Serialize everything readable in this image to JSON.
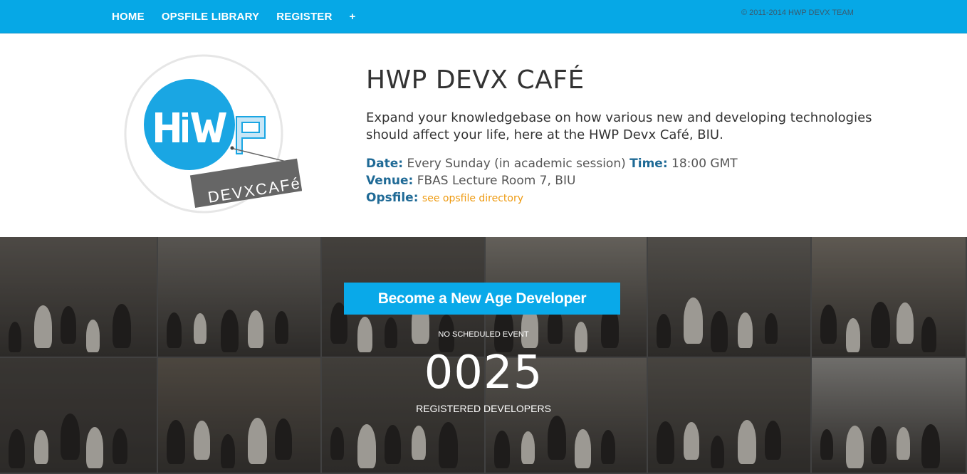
{
  "nav": {
    "items": [
      "HOME",
      "OPSFILE LIBRARY",
      "REGISTER",
      "+"
    ],
    "copyright": "© 2011-2014 HWP DEVX TEAM"
  },
  "logo": {
    "letters": "HiWP",
    "badge": "DEVXCAFé",
    "colors": {
      "circle": "#1aa6e3",
      "badge": "#666666",
      "ring": "#e6e6e6"
    }
  },
  "hero": {
    "title": "HWP DEVX CAFÉ",
    "description": "Expand your knowledgebase on how various new and developing technologies should affect your life, here at the HWP Devx Café, BIU.",
    "date_label": "Date:",
    "date_value": "Every Sunday (in academic session)",
    "time_label": "Time:",
    "time_value": "18:00 GMT",
    "venue_label": "Venue:",
    "venue_value": "FBAS Lecture Room 7, BIU",
    "opsfile_label": "Opsfile:",
    "opsfile_link": "see opsfile directory"
  },
  "band": {
    "cta_label": "Become a New Age Developer",
    "event_status": "NO SCHEDULED EVENT",
    "count": "0025",
    "count_label": "REGISTERED DEVELOPERS"
  },
  "colors": {
    "brand": "#06a8e6",
    "label": "#1f6a96",
    "link": "#ee9a10"
  }
}
